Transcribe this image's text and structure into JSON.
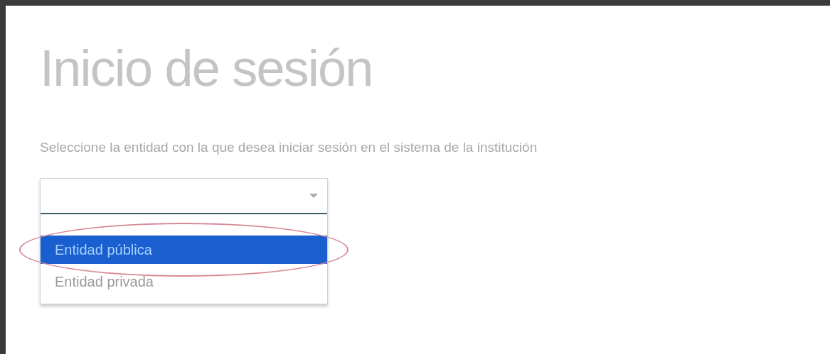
{
  "title": "Inicio de sesión",
  "subtitle": "Seleccione la entidad con la que desea iniciar sesión en el sistema de la institución",
  "dropdown": {
    "options": [
      {
        "label": "Entidad pública",
        "selected": true,
        "highlighted": true
      },
      {
        "label": "Entidad privada",
        "selected": false,
        "highlighted": false
      }
    ]
  }
}
